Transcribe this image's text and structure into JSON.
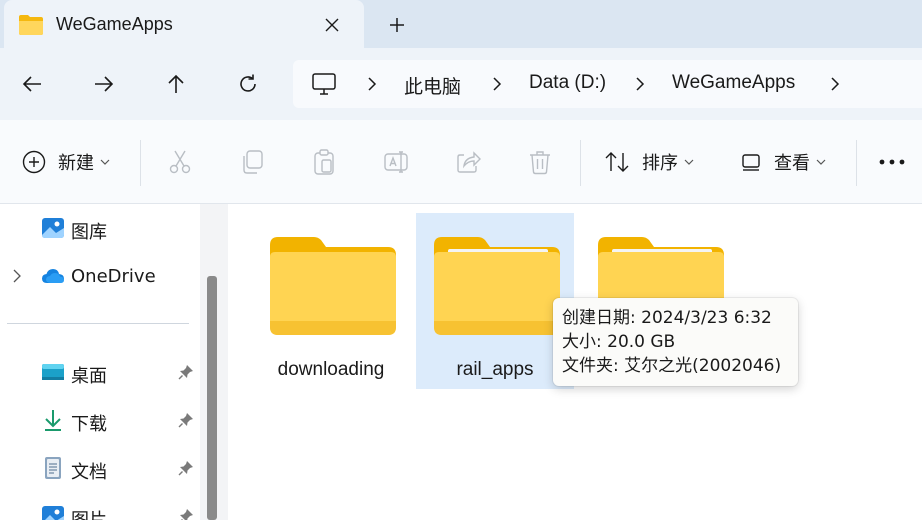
{
  "window": {
    "tab": {
      "title": "WeGameApps",
      "close_glyph": "✕",
      "icon": "folder-icon"
    },
    "new_tab_glyph": "+"
  },
  "nav": {
    "back": "arrow-left-icon",
    "forward": "arrow-right-icon",
    "up": "arrow-up-icon",
    "refresh": "refresh-icon"
  },
  "address": {
    "crumbs": [
      "此电脑",
      "Data (D:)",
      "WeGameApps"
    ]
  },
  "toolbar": {
    "new_label": "新建",
    "sort_label": "排序",
    "view_label": "查看",
    "more_glyph": "•••"
  },
  "sidebar": {
    "items": [
      {
        "label": "图库",
        "icon": "gallery-icon",
        "pinned": false
      },
      {
        "label": "OneDrive",
        "icon": "cloud-icon",
        "pinned": false,
        "expandable": true
      },
      {
        "label": "桌面",
        "icon": "desktop-icon",
        "pinned": true
      },
      {
        "label": "下载",
        "icon": "download-icon",
        "pinned": true
      },
      {
        "label": "文档",
        "icon": "document-icon",
        "pinned": true
      },
      {
        "label": "图片",
        "icon": "pictures-icon",
        "pinned": true
      }
    ]
  },
  "files": [
    {
      "name": "downloading",
      "selected": false
    },
    {
      "name": "rail_apps",
      "selected": true
    },
    {
      "name": "",
      "selected": false
    }
  ],
  "tooltip": {
    "created": "创建日期: 2024/3/23 6:32",
    "size": "大小: 20.0 GB",
    "folders": "文件夹: 艾尔之光(2002046)"
  },
  "colors": {
    "accent": "#0067c0",
    "folder_back": "#f5b80f",
    "folder_front": "#ffd65c",
    "selection": "#dcebfb"
  }
}
